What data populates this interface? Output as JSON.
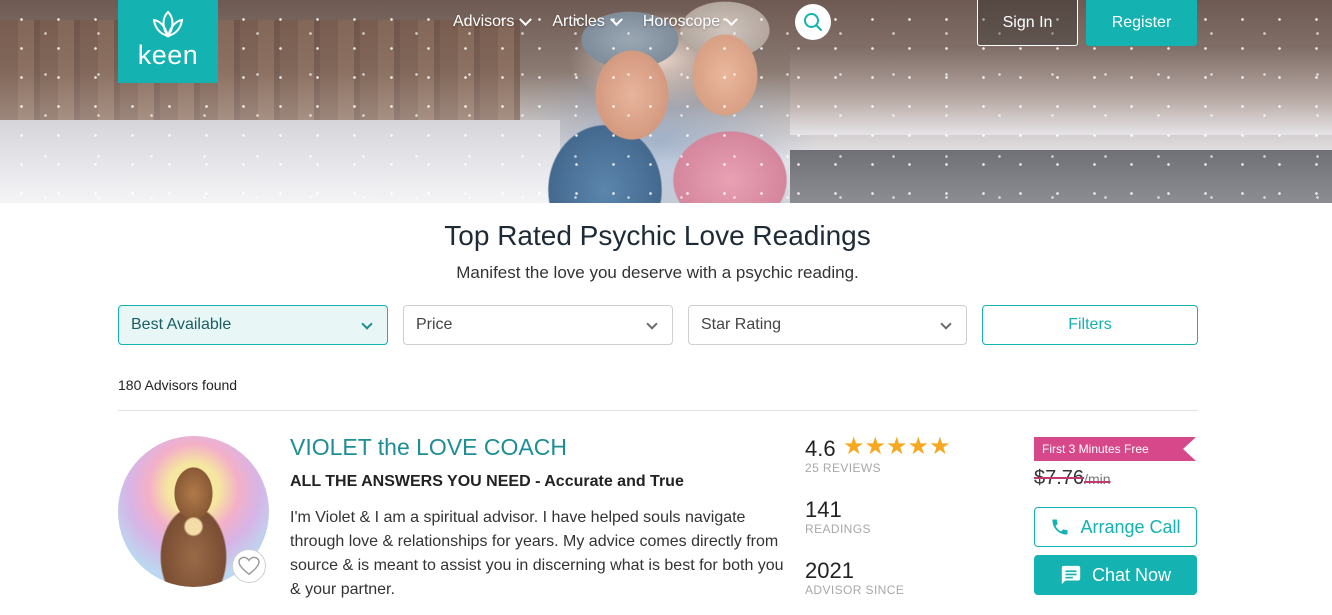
{
  "logo": {
    "text": "keen"
  },
  "nav": {
    "items": [
      {
        "label": "Advisors"
      },
      {
        "label": "Articles"
      },
      {
        "label": "Horoscope"
      }
    ],
    "sign_in": "Sign In",
    "register": "Register"
  },
  "colors": {
    "brand": "#14b2b0",
    "promo": "#d6488a",
    "star": "#f6a821",
    "name": "#1d8e93"
  },
  "header": {
    "title": "Top Rated Psychic Love Readings",
    "subtitle": "Manifest the love you deserve with a psychic reading."
  },
  "filters": {
    "sort": "Best Available",
    "price": "Price",
    "star_rating": "Star Rating",
    "filters_button": "Filters"
  },
  "results": {
    "count_text": "180 Advisors found"
  },
  "advisor": {
    "name": "VIOLET the LOVE COACH",
    "tagline": "ALL THE ANSWERS YOU NEED - Accurate and True",
    "description": "I'm Violet & I am a spiritual advisor. I have helped souls navigate through love & relationships for years. My advice comes directly from source & is meant to assist you in discerning what is best for both you & your partner.",
    "rating": "4.6",
    "stars": 5,
    "reviews_label": "25 REVIEWS",
    "readings": "141",
    "readings_label": "READINGS",
    "since": "2021",
    "since_label": "ADVISOR SINCE",
    "promo": "First 3 Minutes Free",
    "price": "$7.76",
    "price_unit": "/min",
    "arrange_call": "Arrange Call",
    "chat_now": "Chat Now"
  }
}
